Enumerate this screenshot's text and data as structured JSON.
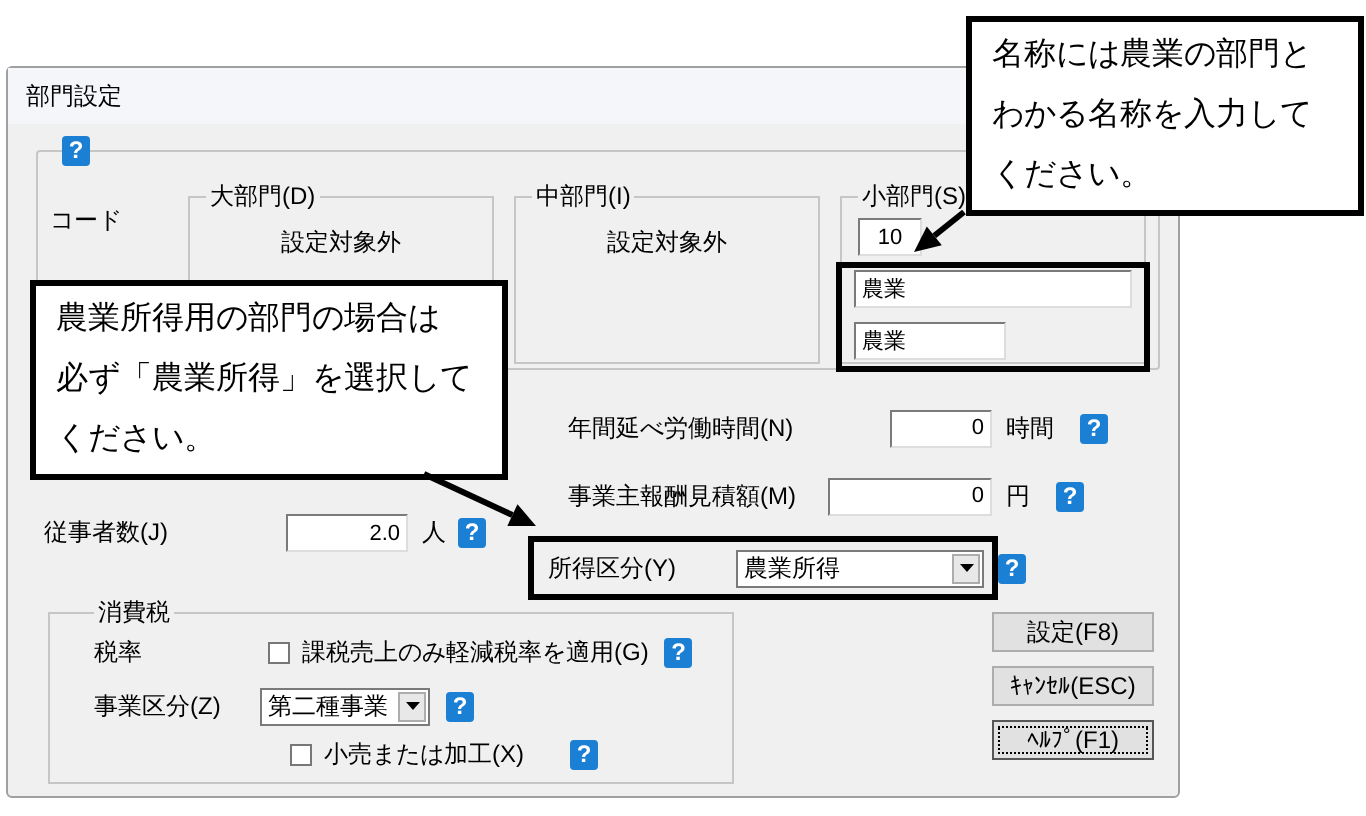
{
  "window": {
    "title": "部門設定"
  },
  "header": {
    "help": "?",
    "code_label": "コード"
  },
  "departments": [
    {
      "kind": "text",
      "label": "大部門(D)",
      "value": "設定対象外"
    },
    {
      "kind": "text",
      "label": "中部門(I)",
      "value": "設定対象外"
    },
    {
      "kind": "fields",
      "label": "小部門(S)",
      "code": "10",
      "name": "農業",
      "short_name": "農業",
      "highlighted": true
    }
  ],
  "fields": [
    {
      "kind": "input",
      "label": "年間延べ労働時間(N)",
      "value": "0",
      "unit": "時間",
      "help": "?",
      "highlighted": false
    },
    {
      "kind": "input",
      "label": "事業主報酬見積額(M)",
      "value": "0",
      "unit": "円",
      "help": "?",
      "highlighted": false
    },
    {
      "kind": "select",
      "label": "所得区分(Y)",
      "value": "農業所得",
      "help": "?",
      "highlighted": true
    }
  ],
  "staff": {
    "label": "従事者数(J)",
    "value": "2.0",
    "unit": "人",
    "help": "?"
  },
  "consumption_tax": {
    "title": "消費税",
    "rate_label": "税率",
    "reduced_rate": {
      "label": "課税売上のみ軽減税率を適用(G)",
      "checked": false,
      "help": "?"
    },
    "business_type": {
      "label": "事業区分(Z)",
      "value": "第二種事業",
      "help": "?"
    },
    "retail": {
      "label": "小売または加工(X)",
      "checked": false,
      "help": "?"
    }
  },
  "buttons": [
    {
      "label": "設定(F8)",
      "focused": false
    },
    {
      "label": "ｷｬﾝｾﾙ(ESC)",
      "focused": false
    },
    {
      "label": "ﾍﾙﾌﾟ(F1)",
      "focused": true
    }
  ],
  "callouts": [
    {
      "kind": "name",
      "lines": [
        "名称には農業の部門と",
        "わかる名称を入力して",
        "ください。"
      ]
    },
    {
      "kind": "income",
      "lines": [
        "農業所得用の部門の場合は",
        "必ず「農業所得」を選択して",
        "ください。"
      ]
    }
  ]
}
